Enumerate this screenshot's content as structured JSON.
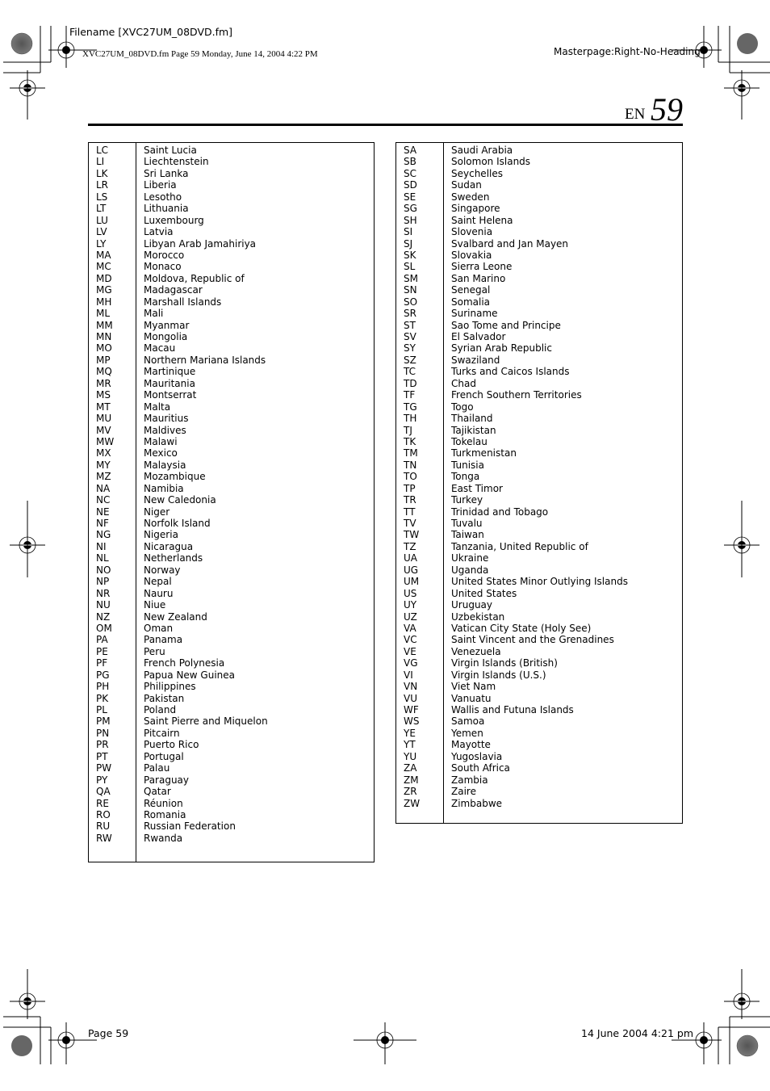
{
  "header": {
    "filename": "Filename [XVC27UM_08DVD.fm]",
    "stamp": "XVC27UM_08DVD.fm  Page 59  Monday, June 14, 2004  4:22 PM",
    "masterpage": "Masterpage:Right-No-Heading",
    "lang": "EN",
    "page_number": "59"
  },
  "footer": {
    "page": "Page 59",
    "date": "14 June 2004 4:21 pm"
  },
  "tables": {
    "left": [
      [
        "LC",
        "Saint Lucia"
      ],
      [
        "LI",
        "Liechtenstein"
      ],
      [
        "LK",
        "Sri Lanka"
      ],
      [
        "LR",
        "Liberia"
      ],
      [
        "LS",
        "Lesotho"
      ],
      [
        "LT",
        "Lithuania"
      ],
      [
        "LU",
        "Luxembourg"
      ],
      [
        "LV",
        "Latvia"
      ],
      [
        "LY",
        "Libyan Arab Jamahiriya"
      ],
      [
        "MA",
        "Morocco"
      ],
      [
        "MC",
        "Monaco"
      ],
      [
        "MD",
        "Moldova, Republic of"
      ],
      [
        "MG",
        "Madagascar"
      ],
      [
        "MH",
        "Marshall Islands"
      ],
      [
        "ML",
        "Mali"
      ],
      [
        "MM",
        "Myanmar"
      ],
      [
        "MN",
        "Mongolia"
      ],
      [
        "MO",
        "Macau"
      ],
      [
        "MP",
        "Northern Mariana Islands"
      ],
      [
        "MQ",
        "Martinique"
      ],
      [
        "MR",
        "Mauritania"
      ],
      [
        "MS",
        "Montserrat"
      ],
      [
        "MT",
        "Malta"
      ],
      [
        "MU",
        "Mauritius"
      ],
      [
        "MV",
        "Maldives"
      ],
      [
        "MW",
        "Malawi"
      ],
      [
        "MX",
        "Mexico"
      ],
      [
        "MY",
        "Malaysia"
      ],
      [
        "MZ",
        "Mozambique"
      ],
      [
        "NA",
        "Namibia"
      ],
      [
        "NC",
        "New Caledonia"
      ],
      [
        "NE",
        "Niger"
      ],
      [
        "NF",
        "Norfolk Island"
      ],
      [
        "NG",
        "Nigeria"
      ],
      [
        "NI",
        "Nicaragua"
      ],
      [
        "NL",
        "Netherlands"
      ],
      [
        "NO",
        "Norway"
      ],
      [
        "NP",
        "Nepal"
      ],
      [
        "NR",
        "Nauru"
      ],
      [
        "NU",
        "Niue"
      ],
      [
        "NZ",
        "New Zealand"
      ],
      [
        "OM",
        "Oman"
      ],
      [
        "PA",
        "Panama"
      ],
      [
        "PE",
        "Peru"
      ],
      [
        "PF",
        "French Polynesia"
      ],
      [
        "PG",
        "Papua New Guinea"
      ],
      [
        "PH",
        "Philippines"
      ],
      [
        "PK",
        "Pakistan"
      ],
      [
        "PL",
        "Poland"
      ],
      [
        "PM",
        "Saint Pierre and Miquelon"
      ],
      [
        "PN",
        "Pitcairn"
      ],
      [
        "PR",
        "Puerto Rico"
      ],
      [
        "PT",
        "Portugal"
      ],
      [
        "PW",
        "Palau"
      ],
      [
        "PY",
        "Paraguay"
      ],
      [
        "QA",
        "Qatar"
      ],
      [
        "RE",
        "Réunion"
      ],
      [
        "RO",
        "Romania"
      ],
      [
        "RU",
        "Russian Federation"
      ],
      [
        "RW",
        "Rwanda"
      ]
    ],
    "right": [
      [
        "SA",
        "Saudi Arabia"
      ],
      [
        "SB",
        "Solomon Islands"
      ],
      [
        "SC",
        "Seychelles"
      ],
      [
        "SD",
        "Sudan"
      ],
      [
        "SE",
        "Sweden"
      ],
      [
        "SG",
        "Singapore"
      ],
      [
        "SH",
        "Saint Helena"
      ],
      [
        "SI",
        "Slovenia"
      ],
      [
        "SJ",
        "Svalbard and Jan Mayen"
      ],
      [
        "SK",
        "Slovakia"
      ],
      [
        "SL",
        "Sierra Leone"
      ],
      [
        "SM",
        "San Marino"
      ],
      [
        "SN",
        "Senegal"
      ],
      [
        "SO",
        "Somalia"
      ],
      [
        "SR",
        "Suriname"
      ],
      [
        "ST",
        "Sao Tome and Principe"
      ],
      [
        "SV",
        "El Salvador"
      ],
      [
        "SY",
        "Syrian Arab Republic"
      ],
      [
        "SZ",
        "Swaziland"
      ],
      [
        "TC",
        "Turks and Caicos Islands"
      ],
      [
        "TD",
        "Chad"
      ],
      [
        "TF",
        "French Southern Territories"
      ],
      [
        "TG",
        "Togo"
      ],
      [
        "TH",
        "Thailand"
      ],
      [
        "TJ",
        "Tajikistan"
      ],
      [
        "TK",
        "Tokelau"
      ],
      [
        "TM",
        "Turkmenistan"
      ],
      [
        "TN",
        "Tunisia"
      ],
      [
        "TO",
        "Tonga"
      ],
      [
        "TP",
        "East Timor"
      ],
      [
        "TR",
        "Turkey"
      ],
      [
        "TT",
        "Trinidad and Tobago"
      ],
      [
        "TV",
        "Tuvalu"
      ],
      [
        "TW",
        "Taiwan"
      ],
      [
        "TZ",
        "Tanzania, United Republic of"
      ],
      [
        "UA",
        "Ukraine"
      ],
      [
        "UG",
        "Uganda"
      ],
      [
        "UM",
        "United States Minor Outlying Islands"
      ],
      [
        "US",
        "United States"
      ],
      [
        "UY",
        "Uruguay"
      ],
      [
        "UZ",
        "Uzbekistan"
      ],
      [
        "VA",
        "Vatican City State (Holy See)"
      ],
      [
        "VC",
        "Saint Vincent and the Grenadines"
      ],
      [
        "VE",
        "Venezuela"
      ],
      [
        "VG",
        "Virgin Islands (British)"
      ],
      [
        "VI",
        "Virgin Islands (U.S.)"
      ],
      [
        "VN",
        "Viet Nam"
      ],
      [
        "VU",
        "Vanuatu"
      ],
      [
        "WF",
        "Wallis and Futuna Islands"
      ],
      [
        "WS",
        "Samoa"
      ],
      [
        "YE",
        "Yemen"
      ],
      [
        "YT",
        "Mayotte"
      ],
      [
        "YU",
        "Yugoslavia"
      ],
      [
        "ZA",
        "South Africa"
      ],
      [
        "ZM",
        "Zambia"
      ],
      [
        "ZR",
        "Zaire"
      ],
      [
        "ZW",
        "Zimbabwe"
      ]
    ]
  }
}
